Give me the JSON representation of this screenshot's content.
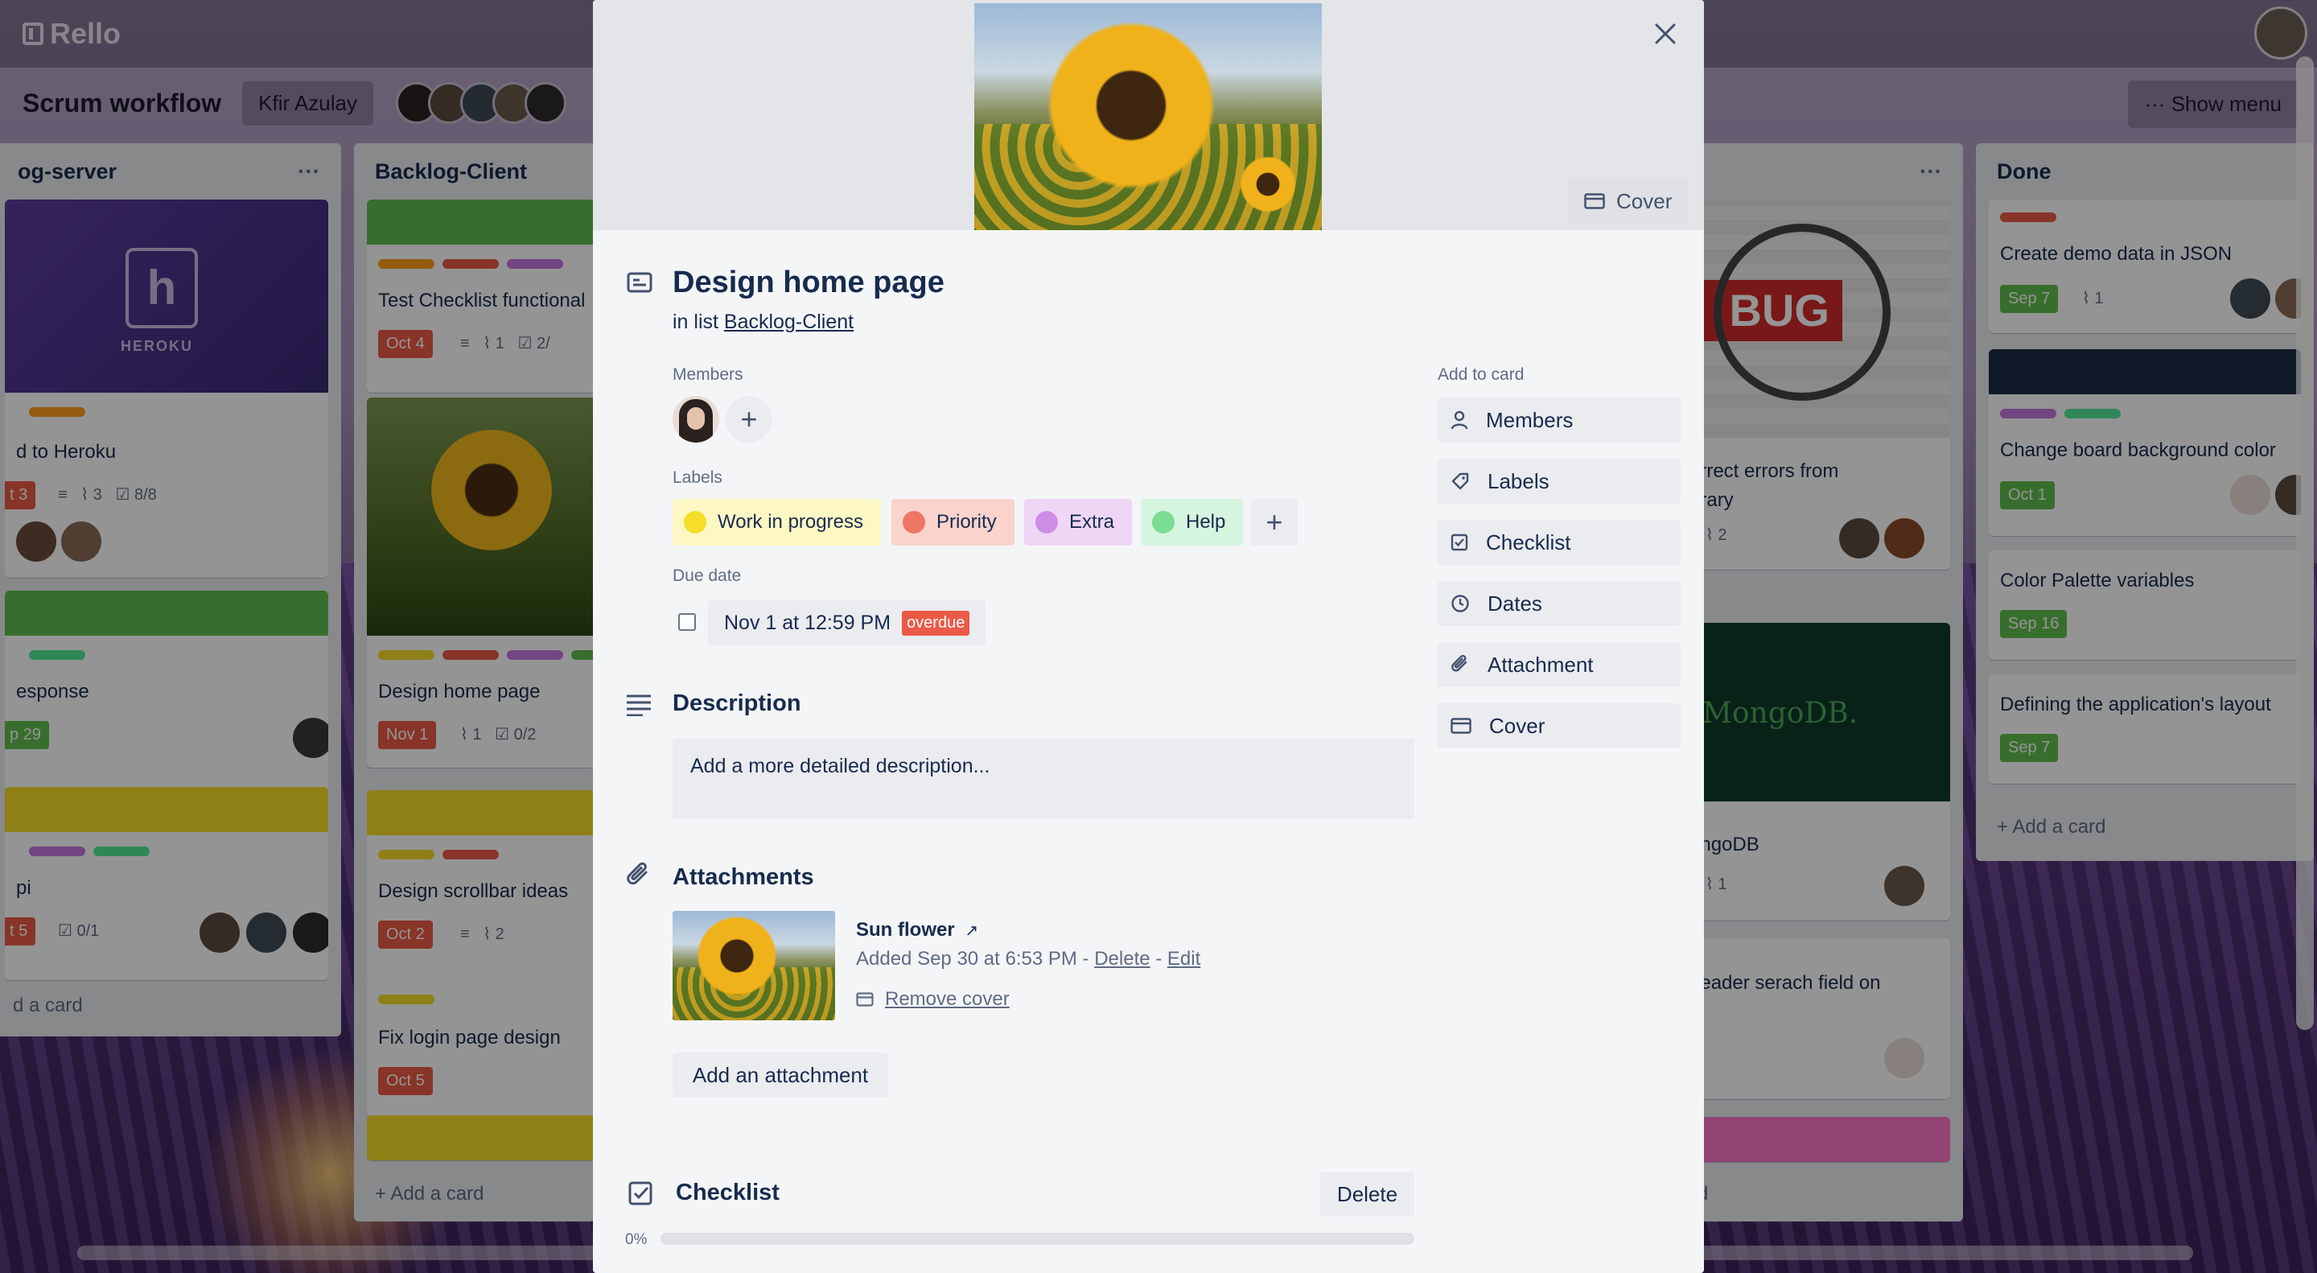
{
  "app": {
    "name": "Rello"
  },
  "board": {
    "title": "Scrum workflow",
    "owner": "Kfir Azulay",
    "show_menu": "Show menu",
    "lists": [
      {
        "title": "og-server",
        "cards": [
          {
            "logo": "HEROKU",
            "title": "d to Heroku",
            "due": "t 3",
            "attachments": "3",
            "checklist": "8/8"
          },
          {
            "title": "esponse",
            "due": "p 29"
          },
          {
            "title": "pi",
            "due": "t 5",
            "checklist": "0/1"
          }
        ],
        "add_card": "d a card"
      },
      {
        "title": "Backlog-Client",
        "cards": [
          {
            "title": "Test Checklist functional",
            "due": "Oct 4",
            "attachments": "1",
            "checklist": "2/"
          },
          {
            "title": "Design home page",
            "due": "Nov 1",
            "attachments": "1",
            "checklist": "0/2"
          },
          {
            "title": "Design scrollbar ideas",
            "due": "Oct 2",
            "attachments": "2"
          },
          {
            "title": "Fix login page design",
            "due": "Oct 5"
          }
        ],
        "add_card": "Add a card"
      },
      {
        "title": "",
        "cards": [
          {
            "title_line1": "orrect errors from",
            "title_line2": "brary",
            "attachments": "2"
          },
          {
            "logo": "MongoDB.",
            "title": "ongoDB",
            "attachments": "1"
          },
          {
            "title": "header serach field on"
          }
        ],
        "add_card": "d"
      },
      {
        "title": "Done",
        "cards": [
          {
            "title": "Create demo data in JSON",
            "due": "Sep 7",
            "attachments": "1"
          },
          {
            "title": "Change board background color",
            "due": "Oct 1"
          },
          {
            "title": "Color Palette variables",
            "due": "Sep 16"
          },
          {
            "title": "Defining the application's layout",
            "due": "Sep 7"
          }
        ],
        "add_card": "Add a card"
      }
    ]
  },
  "modal": {
    "cover_button": "Cover",
    "title": "Design home page",
    "in_list_prefix": "in list",
    "list_name": "Backlog-Client",
    "members_label": "Members",
    "labels_label": "Labels",
    "labels": [
      {
        "name": "Work in progress",
        "bg": "#fdf7c3",
        "dot": "#f5dd29"
      },
      {
        "name": "Priority",
        "bg": "#fad3cd",
        "dot": "#ef7564"
      },
      {
        "name": "Extra",
        "bg": "#efd6f5",
        "dot": "#cd8de5"
      },
      {
        "name": "Help",
        "bg": "#d6f5de",
        "dot": "#7bdc96"
      }
    ],
    "due_label": "Due date",
    "due_value": "Nov 1 at 12:59 PM",
    "due_status": "overdue",
    "description_title": "Description",
    "description_placeholder": "Add a more detailed description...",
    "attachments_title": "Attachments",
    "attachment": {
      "name": "Sun flower",
      "arrow": "↗",
      "added": "Added Sep 30 at 6:53 PM -",
      "delete": "Delete",
      "sep": "-",
      "edit": "Edit",
      "remove_cover": "Remove cover"
    },
    "add_attachment": "Add an attachment",
    "checklist_title": "Checklist",
    "checklist_delete": "Delete",
    "checklist_progress": "0%",
    "add_to_card_label": "Add to card",
    "add_to_card": [
      "Members",
      "Labels",
      "Checklist",
      "Dates",
      "Attachment",
      "Cover"
    ]
  },
  "colors": {
    "red_badge": "#eb5a46",
    "green_badge": "#61bd4f",
    "modal_bg": "#f4f5f7"
  }
}
